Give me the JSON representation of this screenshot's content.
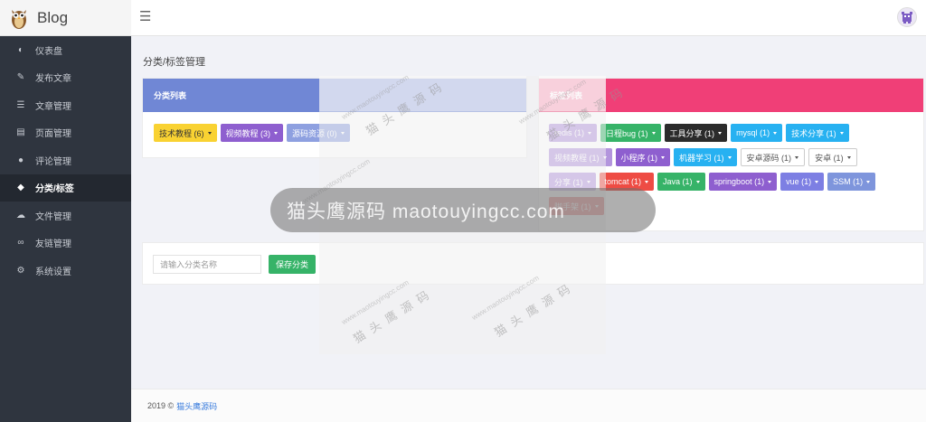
{
  "brand": {
    "title": "Blog"
  },
  "sidebar": {
    "items": [
      {
        "label": "仪表盘",
        "icon": "dashboard-icon",
        "glyph": "◐",
        "active": false
      },
      {
        "label": "发布文章",
        "icon": "edit-icon",
        "glyph": "✎",
        "active": false
      },
      {
        "label": "文章管理",
        "icon": "list-icon",
        "glyph": "☰",
        "active": false
      },
      {
        "label": "页面管理",
        "icon": "file-icon",
        "glyph": "▤",
        "active": false
      },
      {
        "label": "评论管理",
        "icon": "comments-icon",
        "glyph": "●",
        "active": false
      },
      {
        "label": "分类/标签",
        "icon": "tags-icon",
        "glyph": "◆",
        "active": true
      },
      {
        "label": "文件管理",
        "icon": "cloud-upload-icon",
        "glyph": "☁",
        "active": false
      },
      {
        "label": "友链管理",
        "icon": "link-icon",
        "glyph": "∞",
        "active": false
      },
      {
        "label": "系统设置",
        "icon": "gear-icon",
        "glyph": "⚙",
        "active": false
      }
    ]
  },
  "header": {
    "menu_icon": "☰"
  },
  "breadcrumb": "分类/标签管理",
  "categories": {
    "title": "分类列表",
    "items": [
      {
        "label": "技术教程 (6)",
        "color": "#f9d232",
        "text": "#333"
      },
      {
        "label": "视频教程 (3)",
        "color": "#8e5fcf",
        "text": "#fff"
      },
      {
        "label": "源码资源 (0)",
        "color": "#8ea0e0",
        "text": "#fff"
      }
    ]
  },
  "tags": {
    "title": "标签列表",
    "rows": [
      [
        {
          "label": "redis (1)",
          "color": "#b395dd"
        },
        {
          "label": "日程bug (1)",
          "color": "#36b368"
        },
        {
          "label": "工具分享 (1)",
          "color": "#2b2b2b"
        },
        {
          "label": "mysql (1)",
          "color": "#27b1f1"
        },
        {
          "label": "技术分享 (1)",
          "color": "#27b1f1"
        }
      ],
      [
        {
          "label": "视频教程 (1)",
          "color": "#b395dd"
        },
        {
          "label": "小程序 (1)",
          "color": "#8e5fcf"
        },
        {
          "label": "机器学习 (1)",
          "color": "#27b1f1"
        },
        {
          "label": "安卓源码 (1)",
          "color": "#ffffff",
          "light": true
        },
        {
          "label": "安卓 (1)",
          "color": "#ffffff",
          "light": true
        }
      ],
      [
        {
          "label": "分享 (1)",
          "color": "#b395dd"
        },
        {
          "label": "tomcat (1)",
          "color": "#ee4c44"
        },
        {
          "label": "Java (1)",
          "color": "#36b368"
        },
        {
          "label": "springboot (1)",
          "color": "#8e5fcf"
        },
        {
          "label": "vue (1)",
          "color": "#7d7fe3"
        },
        {
          "label": "SSM (1)",
          "color": "#7e95dc"
        }
      ],
      [
        {
          "label": "脚手架 (1)",
          "color": "#e86b6b"
        }
      ]
    ]
  },
  "add_form": {
    "placeholder": "请输入分类名称",
    "save_label": "保存分类"
  },
  "footer": {
    "copyright": "2019 ©",
    "link_text": "猫头鹰源码"
  },
  "watermark": {
    "banner": "猫头鹰源码 maotouyingcc.com",
    "site": "www.maotouyingcc.com",
    "cn": "猫 头 鹰 源 码"
  }
}
